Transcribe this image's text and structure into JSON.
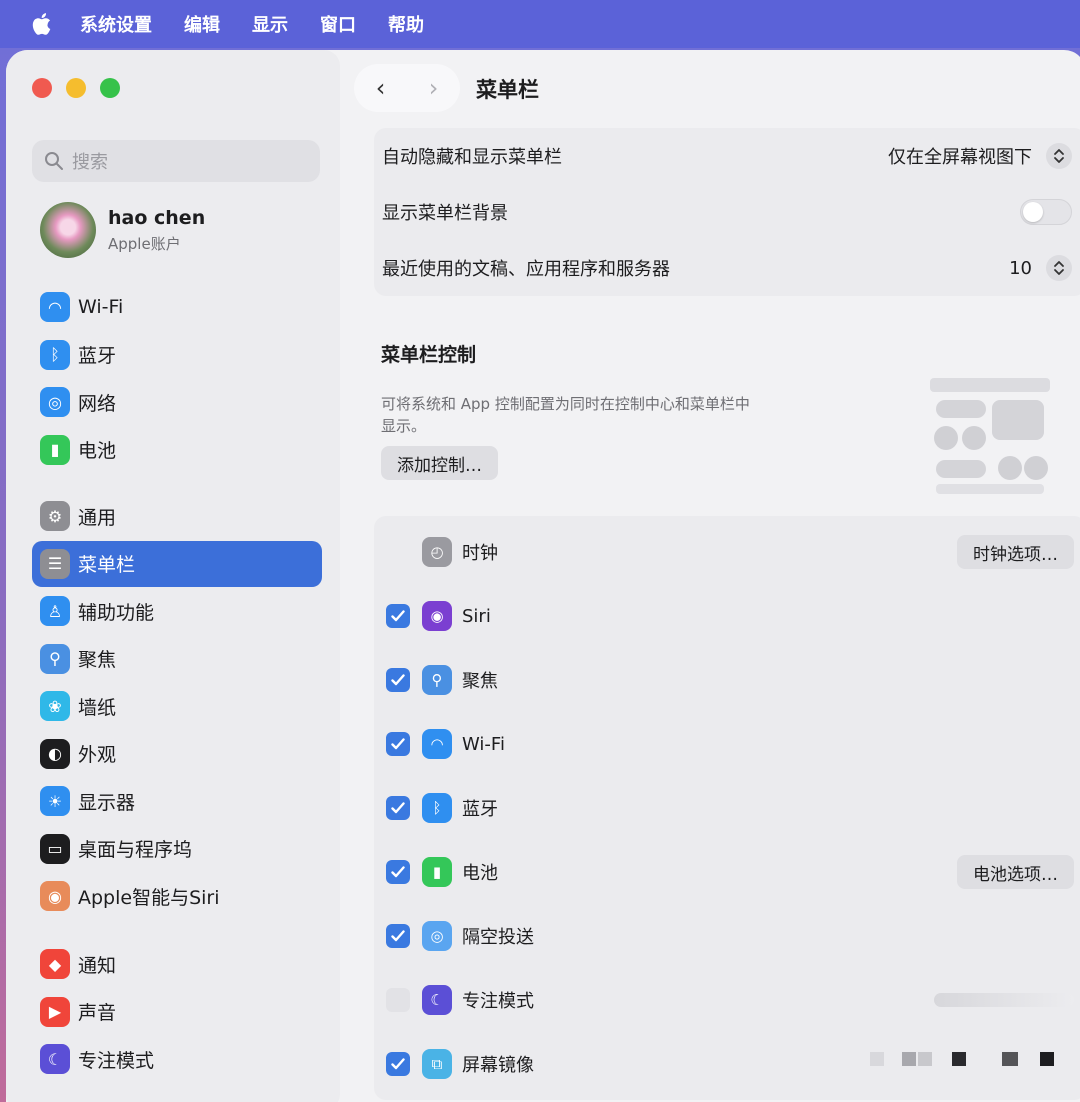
{
  "menubar": {
    "items": [
      "系统设置",
      "编辑",
      "显示",
      "窗口",
      "帮助"
    ]
  },
  "sidebar": {
    "search_placeholder": "搜索",
    "account": {
      "name": "hao chen",
      "subtitle": "Apple账户"
    },
    "groups": [
      [
        {
          "label": "Wi-Fi",
          "icon": "wifi-icon",
          "color": "#2f8ff0"
        },
        {
          "label": "蓝牙",
          "icon": "bluetooth-icon",
          "color": "#2f8ff0"
        },
        {
          "label": "网络",
          "icon": "globe-icon",
          "color": "#2f8ff0"
        },
        {
          "label": "电池",
          "icon": "battery-icon",
          "color": "#34c759"
        }
      ],
      [
        {
          "label": "通用",
          "icon": "gear-icon",
          "color": "#8e8e93"
        },
        {
          "label": "菜单栏",
          "icon": "menubar-icon",
          "color": "#8e8e93",
          "active": true
        },
        {
          "label": "辅助功能",
          "icon": "accessibility-icon",
          "color": "#2f8ff0"
        },
        {
          "label": "聚焦",
          "icon": "spotlight-icon",
          "color": "#4a90e2"
        },
        {
          "label": "墙纸",
          "icon": "wallpaper-icon",
          "color": "#2fb8e8"
        },
        {
          "label": "外观",
          "icon": "appearance-icon",
          "color": "#1d1d1f"
        },
        {
          "label": "显示器",
          "icon": "display-icon",
          "color": "#2f8ff0"
        },
        {
          "label": "桌面与程序坞",
          "icon": "dock-icon",
          "color": "#1d1d1f"
        },
        {
          "label": "Apple智能与Siri",
          "icon": "siri-icon",
          "color": "#e88b5a"
        }
      ],
      [
        {
          "label": "通知",
          "icon": "notification-icon",
          "color": "#f0453a"
        },
        {
          "label": "声音",
          "icon": "sound-icon",
          "color": "#f0453a"
        },
        {
          "label": "专注模式",
          "icon": "moon-icon",
          "color": "#5b4fd6"
        }
      ]
    ]
  },
  "main": {
    "title": "菜单栏",
    "settings": [
      {
        "label": "自动隐藏和显示菜单栏",
        "value": "仅在全屏幕视图下",
        "control": "stepper"
      },
      {
        "label": "显示菜单栏背景",
        "value": "",
        "control": "toggle"
      },
      {
        "label": "最近使用的文稿、应用程序和服务器",
        "value": "10",
        "control": "stepper"
      }
    ],
    "controls_section": {
      "title": "菜单栏控制",
      "description": "可将系统和 App 控制配置为同时在控制中心和菜单栏中显示。",
      "add_button": "添加控制…"
    },
    "items": [
      {
        "label": "时钟",
        "checked": null,
        "icon": "clock-icon",
        "color": "#9a9aa0",
        "button": "时钟选项…"
      },
      {
        "label": "Siri",
        "checked": true,
        "icon": "siri-icon",
        "color": "#7b3fd1",
        "button": ""
      },
      {
        "label": "聚焦",
        "checked": true,
        "icon": "spotlight-icon",
        "color": "#4a90e2",
        "button": ""
      },
      {
        "label": "Wi-Fi",
        "checked": true,
        "icon": "wifi-icon",
        "color": "#2f8ff0",
        "button": ""
      },
      {
        "label": "蓝牙",
        "checked": true,
        "icon": "bluetooth-icon",
        "color": "#2f8ff0",
        "button": ""
      },
      {
        "label": "电池",
        "checked": true,
        "icon": "battery-icon",
        "color": "#34c759",
        "button": "电池选项…"
      },
      {
        "label": "隔空投送",
        "checked": true,
        "icon": "airdrop-icon",
        "color": "#5aa5f0",
        "button": ""
      },
      {
        "label": "专注模式",
        "checked": false,
        "icon": "moon-icon",
        "color": "#5b4fd6",
        "button": ""
      },
      {
        "label": "屏幕镜像",
        "checked": true,
        "icon": "screen-mirroring-icon",
        "color": "#4ab3e6",
        "button": ""
      }
    ]
  }
}
